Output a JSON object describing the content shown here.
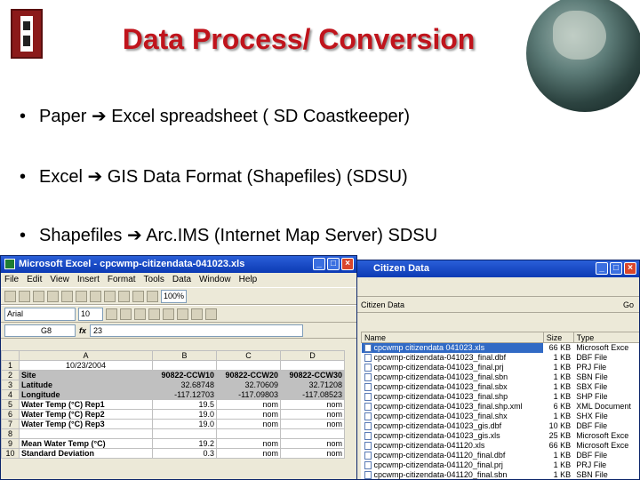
{
  "slide": {
    "title": "Data Process/ Conversion",
    "bullets": [
      {
        "left": "Paper",
        "right": "Excel spreadsheet ( SD  Coastkeeper)"
      },
      {
        "left": "Excel",
        "right": "GIS Data Format (Shapefiles)  (SDSU)"
      },
      {
        "left": "Shapefiles",
        "right": "Arc.IMS (Internet Map Server) SDSU"
      }
    ],
    "arrow": "➔"
  },
  "excel": {
    "title": "Microsoft Excel - cpcwmp-citizendata-041023.xls",
    "menu": [
      "File",
      "Edit",
      "View",
      "Insert",
      "Format",
      "Tools",
      "Data",
      "Window",
      "Help"
    ],
    "font_name": "Arial",
    "font_size": "10",
    "zoom": "100%",
    "name_box": "G8",
    "fx": "fx",
    "formula_value": "23",
    "columns": [
      "",
      "A",
      "B",
      "C",
      "D"
    ],
    "rows": [
      {
        "n": "1",
        "a": "10/23/2004",
        "b": "",
        "c": "",
        "d": ""
      },
      {
        "n": "2",
        "a": "Site",
        "b": "90822-CCW10",
        "c": "90822-CCW20",
        "d": "90822-CCW30"
      },
      {
        "n": "3",
        "a": "Latitude",
        "b": "32.68748",
        "c": "32.70609",
        "d": "32.71208"
      },
      {
        "n": "4",
        "a": "Longitude",
        "b": "-117.12703",
        "c": "-117.09803",
        "d": "-117.08523"
      },
      {
        "n": "5",
        "a": "Water Temp (°C) Rep1",
        "b": "19.5",
        "c": "nom",
        "d": "nom"
      },
      {
        "n": "6",
        "a": "Water Temp (°C) Rep2",
        "b": "19.0",
        "c": "nom",
        "d": "nom"
      },
      {
        "n": "7",
        "a": "Water Temp (°C) Rep3",
        "b": "19.0",
        "c": "nom",
        "d": "nom"
      },
      {
        "n": "8",
        "a": "",
        "b": "",
        "c": "",
        "d": ""
      },
      {
        "n": "9",
        "a": "Mean Water Temp (°C)",
        "b": "19.2",
        "c": "nom",
        "d": "nom"
      },
      {
        "n": "10",
        "a": "Standard Deviation",
        "b": "0.3",
        "c": "nom",
        "d": "nom"
      }
    ]
  },
  "explorer": {
    "title": "Citizen Data",
    "address": "Citizen Data",
    "go_label": "Go",
    "headers": {
      "name": "Name",
      "size": "Size",
      "type": "Type"
    },
    "files": [
      {
        "name": "cpcwmp citizendata 041023.xls",
        "size": "66 KB",
        "type": "Microsoft Exce"
      },
      {
        "name": "cpcwmp-citizendata-041023_final.dbf",
        "size": "1 KB",
        "type": "DBF File"
      },
      {
        "name": "cpcwmp-citizendata-041023_final.prj",
        "size": "1 KB",
        "type": "PRJ File"
      },
      {
        "name": "cpcwmp-citizendata-041023_final.sbn",
        "size": "1 KB",
        "type": "SBN File"
      },
      {
        "name": "cpcwmp-citizendata-041023_final.sbx",
        "size": "1 KB",
        "type": "SBX File"
      },
      {
        "name": "cpcwmp-citizendata-041023_final.shp",
        "size": "1 KB",
        "type": "SHP File"
      },
      {
        "name": "cpcwmp-citizendata-041023_final.shp.xml",
        "size": "6 KB",
        "type": "XML Document"
      },
      {
        "name": "cpcwmp-citizendata-041023_final.shx",
        "size": "1 KB",
        "type": "SHX File"
      },
      {
        "name": "cpcwmp-citizendata-041023_gis.dbf",
        "size": "10 KB",
        "type": "DBF File"
      },
      {
        "name": "cpcwmp-citizendata-041023_gis.xls",
        "size": "25 KB",
        "type": "Microsoft Exce"
      },
      {
        "name": "cpcwmp-citizendata-041120.xls",
        "size": "66 KB",
        "type": "Microsoft Exce"
      },
      {
        "name": "cpcwmp-citizendata-041120_final.dbf",
        "size": "1 KB",
        "type": "DBF File"
      },
      {
        "name": "cpcwmp-citizendata-041120_final.prj",
        "size": "1 KB",
        "type": "PRJ File"
      },
      {
        "name": "cpcwmp-citizendata-041120_final.sbn",
        "size": "1 KB",
        "type": "SBN File"
      }
    ]
  }
}
